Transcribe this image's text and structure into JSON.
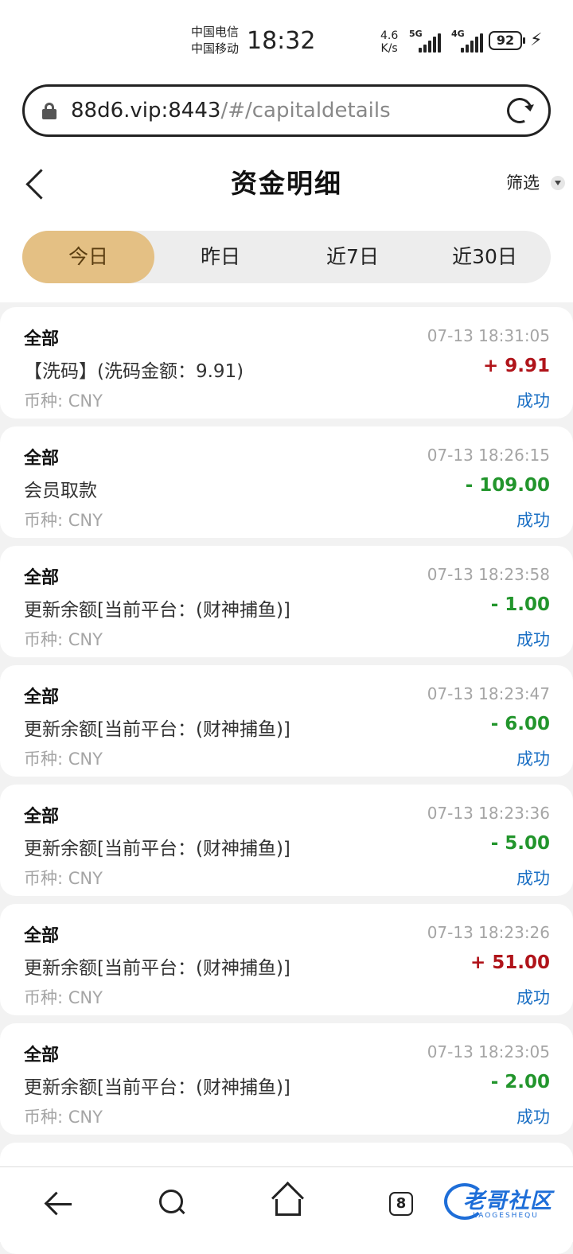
{
  "status_bar": {
    "carrier1": "中国电信",
    "carrier2": "中国移动",
    "time": "18:32",
    "speed_value": "4.6",
    "speed_unit": "K/s",
    "sim1_label": "5G",
    "sim2_label": "4G",
    "battery": "92"
  },
  "browser": {
    "url_host": "88d6.vip:8443",
    "url_path": "/#/capitaldetails"
  },
  "header": {
    "title": "资金明细",
    "filter_label": "筛选"
  },
  "tabs": [
    {
      "label": "今日",
      "active": true
    },
    {
      "label": "昨日",
      "active": false
    },
    {
      "label": "近7日",
      "active": false
    },
    {
      "label": "近30日",
      "active": false
    }
  ],
  "records": [
    {
      "category": "全部",
      "time": "07-13 18:31:05",
      "desc": "【洗码】(洗码金额：9.91)",
      "amount": "+ 9.91",
      "positive": true,
      "currency": "币种: CNY",
      "status": "成功"
    },
    {
      "category": "全部",
      "time": "07-13 18:26:15",
      "desc": "会员取款",
      "amount": "- 109.00",
      "positive": false,
      "currency": "币种: CNY",
      "status": "成功"
    },
    {
      "category": "全部",
      "time": "07-13 18:23:58",
      "desc": "更新余额[当前平台：(财神捕鱼)]",
      "amount": "- 1.00",
      "positive": false,
      "currency": "币种: CNY",
      "status": "成功"
    },
    {
      "category": "全部",
      "time": "07-13 18:23:47",
      "desc": "更新余额[当前平台：(财神捕鱼)]",
      "amount": "- 6.00",
      "positive": false,
      "currency": "币种: CNY",
      "status": "成功"
    },
    {
      "category": "全部",
      "time": "07-13 18:23:36",
      "desc": "更新余额[当前平台：(财神捕鱼)]",
      "amount": "- 5.00",
      "positive": false,
      "currency": "币种: CNY",
      "status": "成功"
    },
    {
      "category": "全部",
      "time": "07-13 18:23:26",
      "desc": "更新余额[当前平台：(财神捕鱼)]",
      "amount": "+ 51.00",
      "positive": true,
      "currency": "币种: CNY",
      "status": "成功"
    },
    {
      "category": "全部",
      "time": "07-13 18:23:05",
      "desc": "更新余额[当前平台：(财神捕鱼)]",
      "amount": "- 2.00",
      "positive": false,
      "currency": "币种: CNY",
      "status": "成功"
    }
  ],
  "bottom_nav": {
    "tab_count": "8",
    "logo_text": "老哥社区",
    "logo_sub": "LAOGESHEQU"
  },
  "colors": {
    "positive": "#b0141a",
    "negative": "#22952c",
    "status": "#1a6fc4",
    "active_tab": "#e4c084"
  }
}
